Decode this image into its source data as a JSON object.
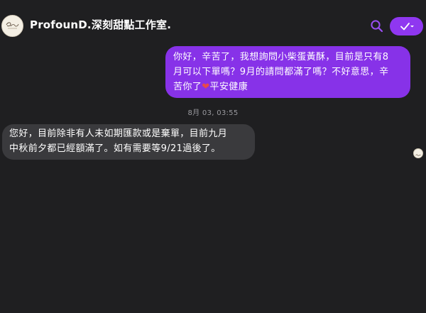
{
  "header": {
    "title": "ProfounD.深刻甜點工作室.",
    "avatar_logo_text": "ProfounD",
    "search_icon": "search-icon",
    "done_icon": "checkmark-dropdown-icon",
    "accent_color": "#8f37f0"
  },
  "conversation": {
    "outgoing_message": {
      "line1": "你好，辛苦了，我想詢問小柴蛋黃酥，目前是只有8",
      "line2": "月可以下單嗎？9月的請問都滿了嗎？不好意思，辛",
      "line3_before_emoji": "苦你了",
      "emoji": "❤",
      "line3_after_emoji": "平安健康",
      "bubble_color": "#8732e8"
    },
    "timestamp": "8月 03, 03:55",
    "incoming_message": {
      "line1": "您好，目前除非有人未如期匯款或是棄單，目前九月",
      "line2": "中秋前夕都已經額滿了。如有需要等9/21過後了。",
      "bubble_color": "#3a3a3d"
    },
    "read_receipt_icon": "seen-avatar-icon"
  }
}
